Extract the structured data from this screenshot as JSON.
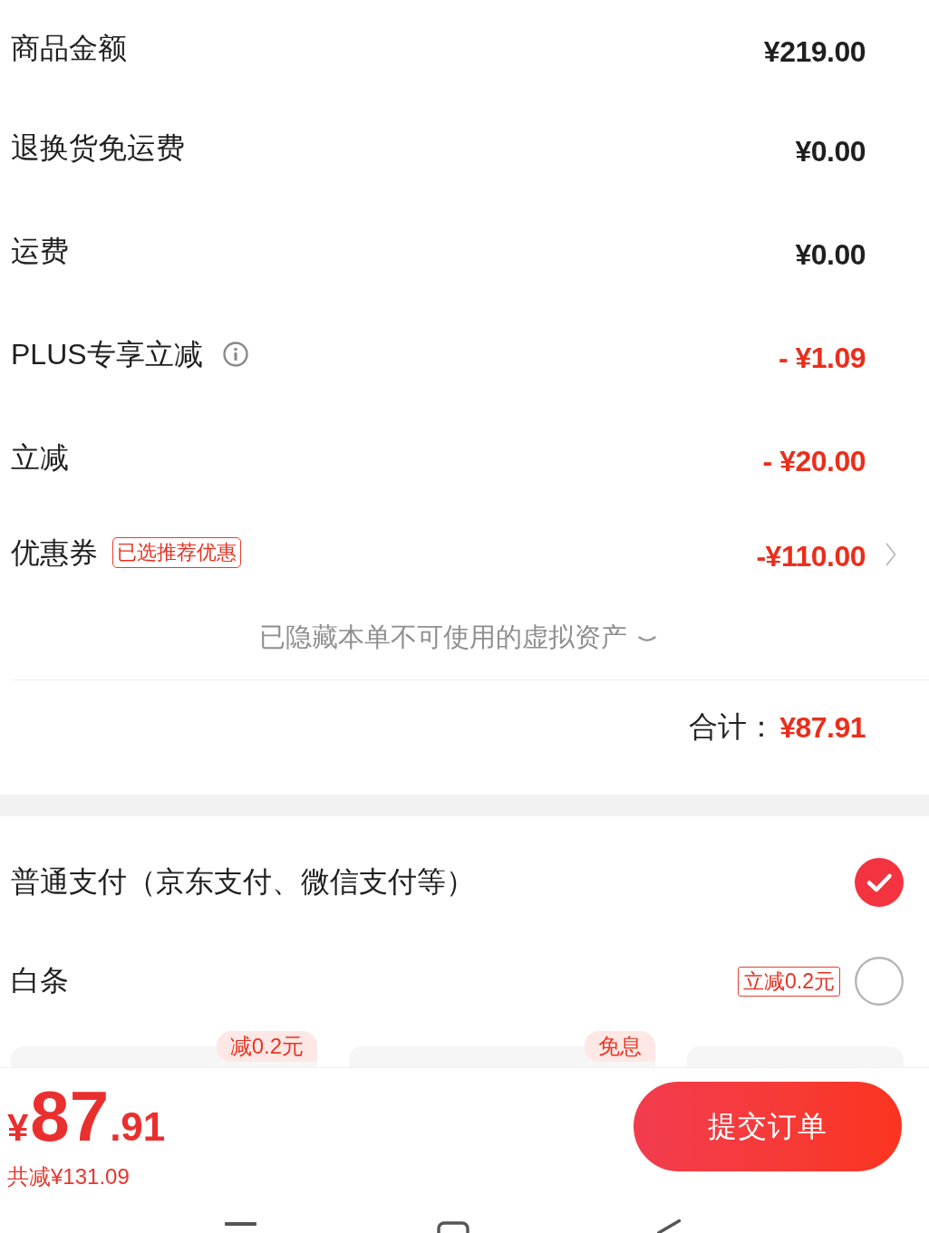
{
  "price_rows": [
    {
      "label": "商品金额",
      "value": "¥219.00",
      "kind": "amount",
      "info": false,
      "opens_detail": false
    },
    {
      "label": "退换货免运费",
      "value": "¥0.00",
      "kind": "amount",
      "info": false,
      "opens_detail": false
    },
    {
      "label": "运费",
      "value": "¥0.00",
      "kind": "amount",
      "info": false,
      "opens_detail": false
    },
    {
      "label": "PLUS专享立减",
      "value": "- ¥1.09",
      "kind": "discount",
      "info": true,
      "opens_detail": false
    },
    {
      "label": "立减",
      "value": "- ¥20.00",
      "kind": "discount",
      "info": false,
      "opens_detail": false
    },
    {
      "label": "优惠券",
      "tag": "已选推荐优惠",
      "value": "-¥110.00",
      "kind": "discount",
      "info": false,
      "opens_detail": true
    }
  ],
  "hidden_assets_note": {
    "text": "已隐藏本单不可使用的虚拟资产",
    "expanded": false
  },
  "total": {
    "label": "合计：",
    "value": "¥87.91"
  },
  "payment_methods": [
    {
      "label": "普通支付（京东支付、微信支付等）",
      "selected": true
    },
    {
      "label": "白条",
      "tag": "立减0.2元",
      "selected": false
    }
  ],
  "installment_plans": [
    {
      "kind": "tagged",
      "badge": "减0.2元"
    },
    {
      "kind": "tagged",
      "badge": "免息"
    },
    {
      "kind": "plain"
    }
  ],
  "footer": {
    "currency": "¥",
    "price_integer": "87",
    "price_decimal": ".91",
    "savings": "共减¥131.09",
    "submit_button": "提交订单"
  }
}
